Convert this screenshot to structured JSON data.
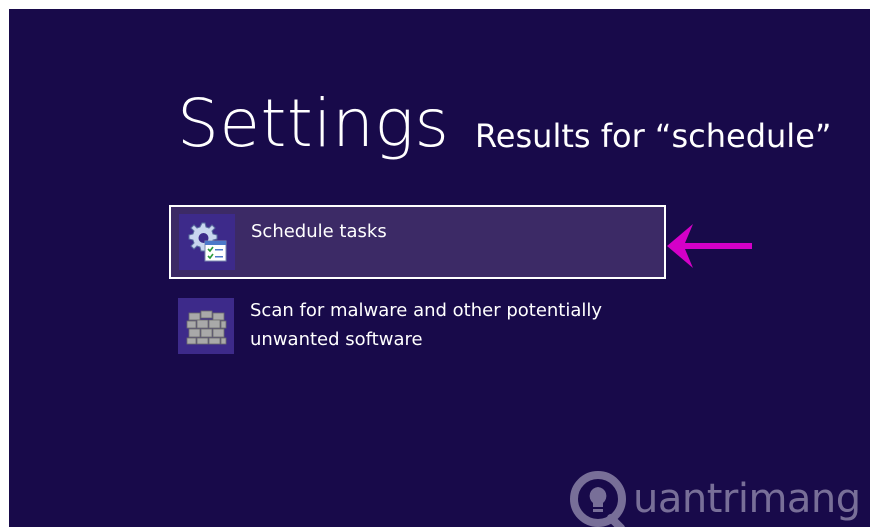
{
  "page": {
    "title": "Settings",
    "subtitle": "Results for “schedule”"
  },
  "results": [
    {
      "label": "Schedule tasks",
      "icon": "schedule-tasks-icon",
      "selected": true
    },
    {
      "label": "Scan for malware and other potentially unwanted software",
      "icon": "firewall-icon",
      "selected": false
    }
  ],
  "annotation": {
    "icon": "arrow-left-icon",
    "color": "#d400c8"
  },
  "watermark": {
    "text": "uantrimang",
    "icon": "lightbulb-icon"
  },
  "colors": {
    "background": "#180a4a",
    "selected": "#3c2a66",
    "tile": "#3d2a8a"
  }
}
